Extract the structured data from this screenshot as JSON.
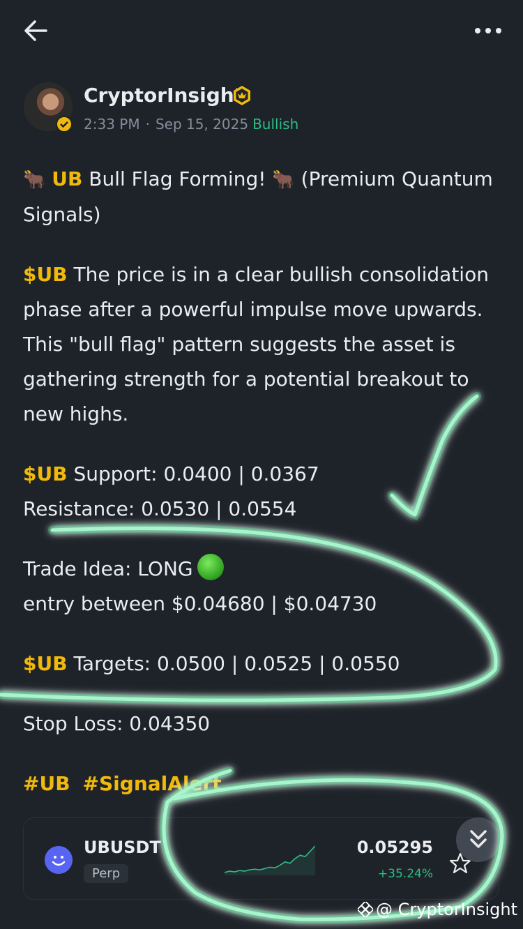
{
  "header": {
    "back_icon": "arrow-left-icon",
    "more_icon": "more-horizontal-icon"
  },
  "post": {
    "author": "CryptorInsight",
    "time": "2:33 PM",
    "date": "Sep 15, 2025",
    "sentiment": "Bullish",
    "title_ticker": "UB",
    "title_text": " Bull Flag Forming! ",
    "title_suffix": "(Premium Quantum Signals)",
    "cashtag": "$UB",
    "body": "  The price is in a clear bullish consolidation phase after a powerful impulse move upwards. This \"bull flag\" pattern suggests the asset is gathering strength for a potential breakout to new highs.",
    "support": " Support: 0.0400 | 0.0367",
    "resistance": "Resistance: 0.0530 | 0.0554",
    "trade_idea": "Trade Idea: LONG",
    "entry": "entry between $0.04680 | $0.04730",
    "targets": " Targets: 0.0500 | 0.0525 | 0.0550",
    "stop_loss": "Stop Loss: 0.04350",
    "hashtags": [
      "#UB",
      "#SignalAlert"
    ]
  },
  "card": {
    "pair": "UBUSDT",
    "type": "Perp",
    "price": "0.05295",
    "change": "+35.24%",
    "sparkline": [
      2,
      2.2,
      2.1,
      2.3,
      2.2,
      2.4,
      2.5,
      2.4,
      2.6,
      2.8,
      2.7,
      3.1,
      3.6,
      3.4,
      4.1,
      4.6,
      4.4,
      5.2,
      6.0
    ],
    "colors": {
      "up": "#2ebd85",
      "accent": "#f0b90b"
    }
  },
  "watermark": "@ CryptorInsight"
}
